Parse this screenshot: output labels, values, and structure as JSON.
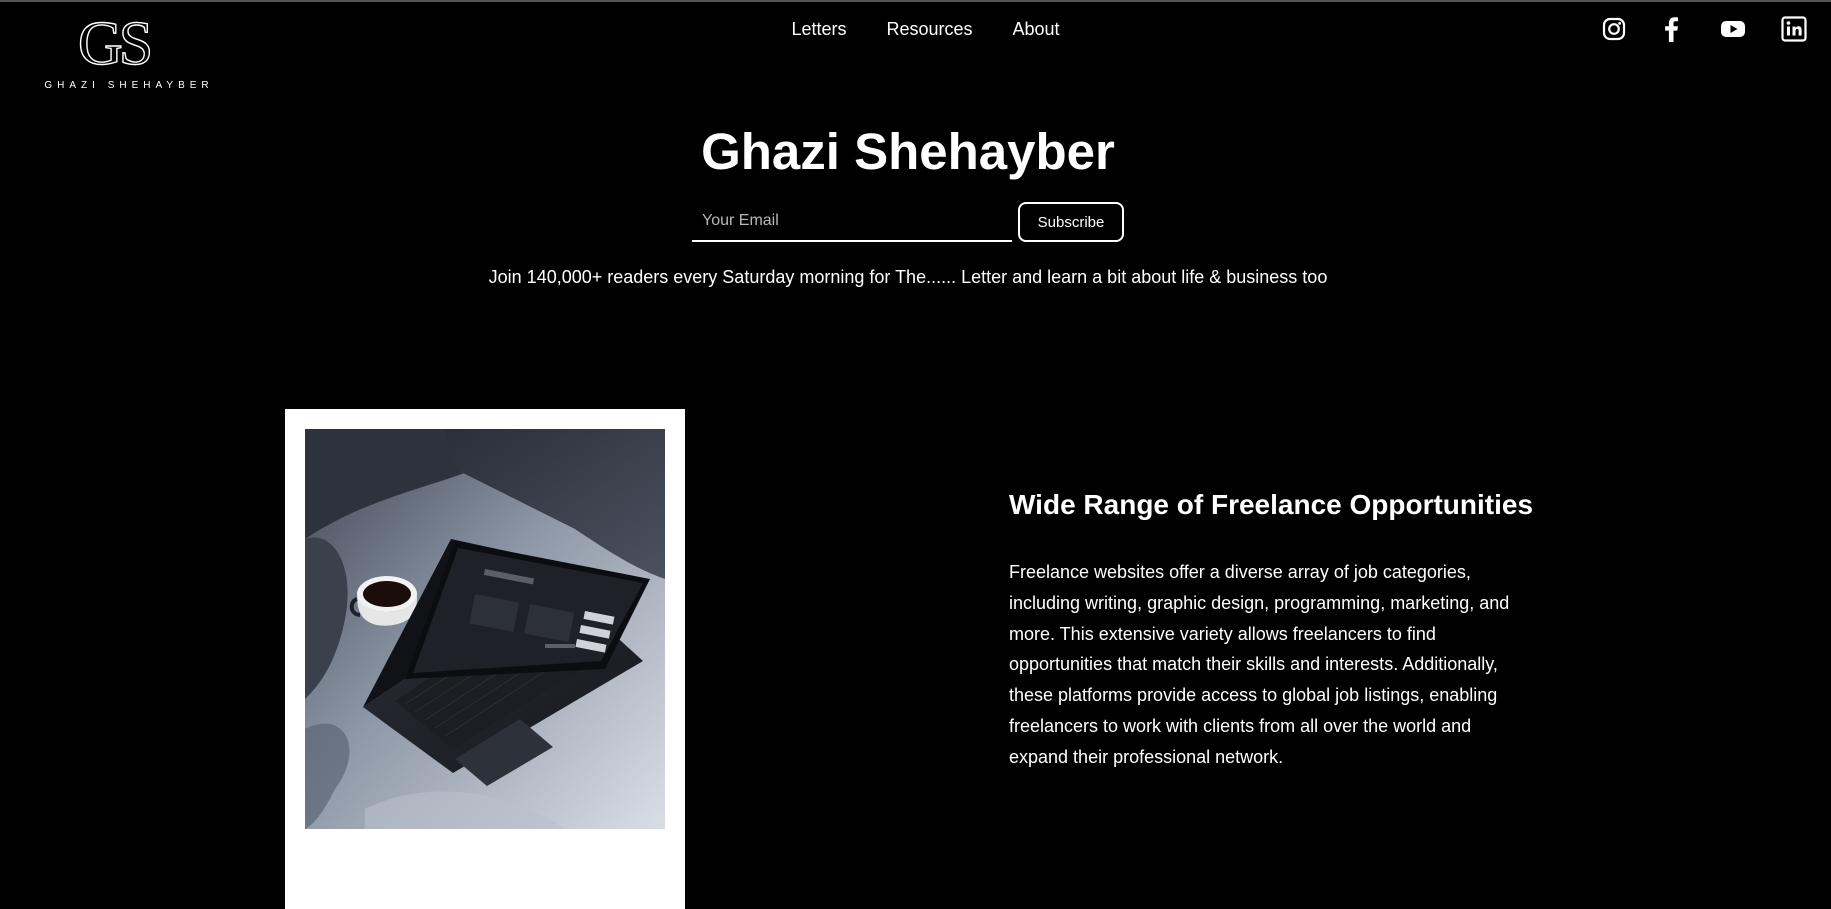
{
  "header": {
    "logo": {
      "monogram": "GS",
      "name": "GHAZI SHEHAYBER"
    },
    "nav": [
      {
        "label": "Letters"
      },
      {
        "label": "Resources"
      },
      {
        "label": "About"
      }
    ],
    "social": [
      {
        "icon": "instagram-icon"
      },
      {
        "icon": "facebook-icon"
      },
      {
        "icon": "youtube-icon"
      },
      {
        "icon": "linkedin-icon"
      }
    ]
  },
  "hero": {
    "title": "Ghazi Shehayber",
    "email_placeholder": "Your Email",
    "subscribe_label": "Subscribe",
    "tagline": "Join 140,000+ readers every Saturday morning for The...... Letter and learn a bit about life & business too"
  },
  "feature": {
    "image": "laptop-on-bed-with-coffee-cup",
    "title": "Wide Range of Freelance Opportunities",
    "body": "Freelance websites offer a diverse array of job categories, including writing, graphic design, programming, marketing, and more. This extensive variety allows freelancers to find opportunities that match their skills and interests. Additionally, these platforms provide access to global job listings, enabling freelancers to work with clients from all over the world and expand their professional network."
  },
  "colors": {
    "background": "#000000",
    "text": "#ffffff",
    "frame": "#ffffff"
  }
}
